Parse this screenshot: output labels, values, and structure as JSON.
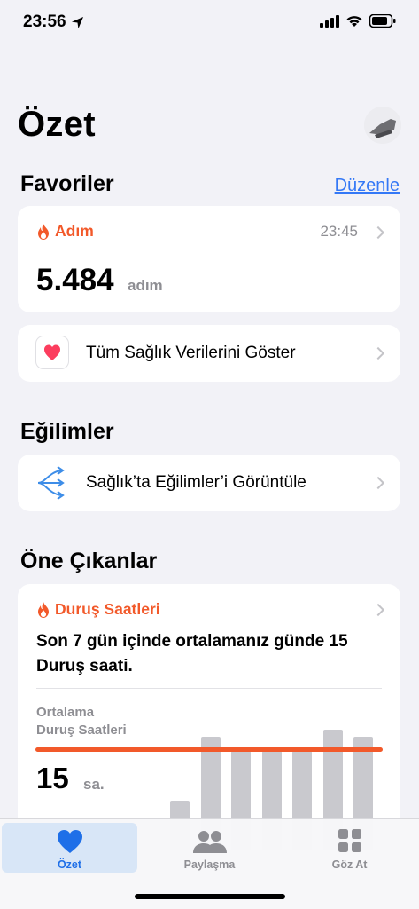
{
  "status_bar": {
    "time": "23:56"
  },
  "page": {
    "title": "Özet"
  },
  "favorites": {
    "title": "Favoriler",
    "edit_label": "Düzenle",
    "steps_card": {
      "label": "Adım",
      "time": "23:45",
      "value": "5.484",
      "unit": "adım"
    },
    "all_data_row": {
      "label": "Tüm Sağlık Verilerini Göster"
    }
  },
  "trends": {
    "title": "Eğilimler",
    "row_label": "Sağlık’ta Eğilimler’i Görüntüle"
  },
  "highlights": {
    "title": "Öne Çıkanlar",
    "card": {
      "label": "Duruş Saatleri",
      "text": "Son 7 gün içinde ortalamanız günde 15 Duruş saati.",
      "avg_label_line1": "Ortalama",
      "avg_label_line2": "Duruş Saatleri",
      "avg_value": "15",
      "avg_unit": "sa."
    },
    "chart_data": {
      "type": "bar",
      "average": 15,
      "values": [
        7,
        16,
        14,
        14,
        14,
        17,
        16
      ],
      "accent_color": "#f2592a"
    }
  },
  "tabbar": {
    "items": [
      {
        "label": "Özet",
        "icon": "heart-icon",
        "active": true
      },
      {
        "label": "Paylaşma",
        "icon": "people-icon",
        "active": false
      },
      {
        "label": "Göz At",
        "icon": "grid-icon",
        "active": false
      }
    ]
  },
  "colors": {
    "accent": "#f2592a",
    "link": "#3478f6",
    "tab_active": "#1e6fe8"
  }
}
